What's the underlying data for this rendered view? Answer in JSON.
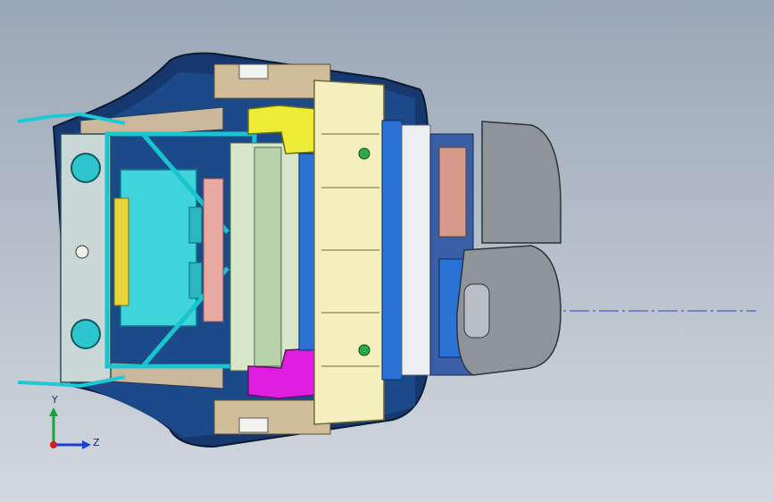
{
  "view": {
    "background_top": "#9aa7b6",
    "background_bottom": "#d3d8de",
    "colors": {
      "shell": "#15386e",
      "frame": "#19c4cf",
      "cyan_fill": "#3fd3dc",
      "cream": "#f4efbd",
      "yellow_part": "#e9ea34",
      "magenta_part": "#df1fdf",
      "blue_part": "#2a72d6",
      "headrest": "#8e9499",
      "pink": "#e8a9a3",
      "grey_foam": "#b6b2a7"
    }
  },
  "triad": {
    "y_label": "Y",
    "z_label": "Z",
    "icons": [
      "y-axis-arrow-icon",
      "z-axis-arrow-icon",
      "origin-dot-icon"
    ]
  }
}
